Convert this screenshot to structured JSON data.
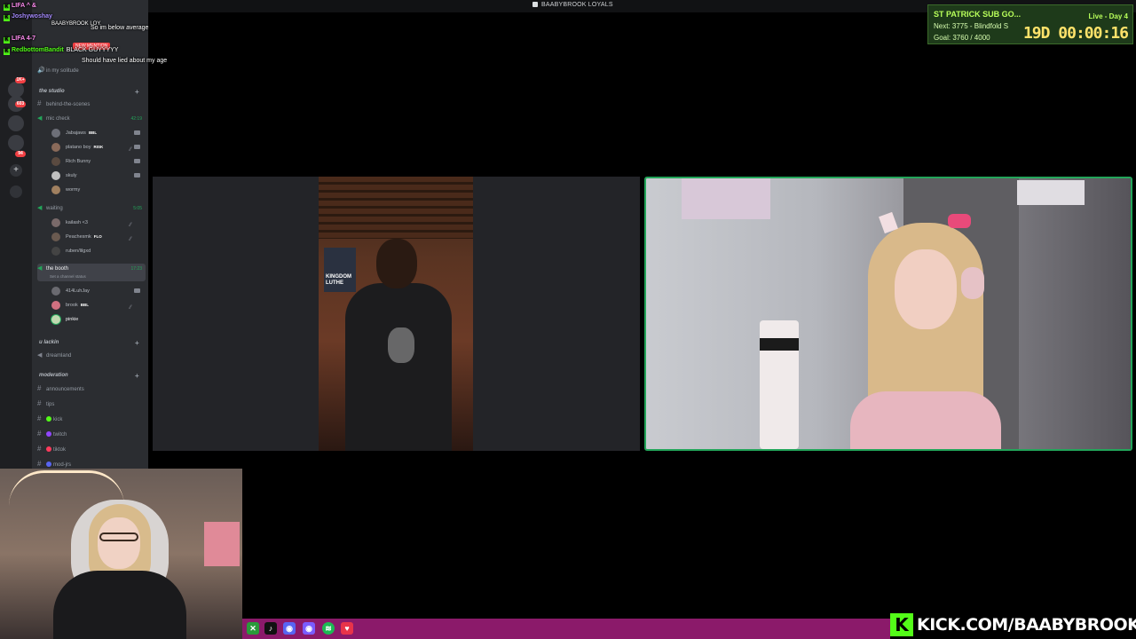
{
  "window": {
    "title": "BAABYBROOK LOYALS"
  },
  "chat": [
    {
      "badge": "K",
      "user": "LIFA ^ &",
      "text": "",
      "color": "#ff8cf0"
    },
    {
      "badge": "K",
      "user": "Joshywoshay",
      "text": "",
      "color": "#a78bff"
    },
    {
      "badge": "K",
      "user": "",
      "text": "So im below average",
      "color": "#ffffff"
    },
    {
      "badge": "K",
      "user": "LIFA 4-7",
      "text": "",
      "color": "#ff8cf0"
    },
    {
      "badge": "K",
      "user": "RedbottomBandit",
      "text": "BLACK GUYYYYY",
      "color": "#53fc18"
    },
    {
      "badge": "K",
      "user": "",
      "text": "Should have lied about my age",
      "color": "#ffffff"
    }
  ],
  "chat_misc": {
    "loy": "BAABYBROOK LOY",
    "new_mention": "NEW MENTION"
  },
  "sidebar": {
    "top_channel": "in my solitude",
    "cat1": "the studio",
    "ch_behind": "behind-the-scenes",
    "ch_mic": "mic check",
    "ch_mic_time": "42:19",
    "users1": [
      {
        "name": "Jabajaws",
        "tag": "BBL"
      },
      {
        "name": "platano boy",
        "tag": "RISK"
      },
      {
        "name": "Rich Bunny",
        "tag": ""
      },
      {
        "name": "skuly",
        "tag": ""
      },
      {
        "name": "wormy",
        "tag": ""
      }
    ],
    "ch_waiting": "waiting",
    "ch_waiting_time": "5:05",
    "users2": [
      {
        "name": "kailash <3",
        "tag": ""
      },
      {
        "name": "Peachesmk",
        "tag": "FLO"
      },
      {
        "name": "ruben/lilgxd",
        "tag": ""
      }
    ],
    "ch_booth": "the booth",
    "ch_booth_time": "17:23",
    "ch_booth_status": "Set a channel status",
    "users3": [
      {
        "name": "414LuhJay",
        "tag": ""
      },
      {
        "name": "brook",
        "tag": "BBL"
      },
      {
        "name": "pinkie",
        "tag": ""
      }
    ],
    "cat2": "u lackin",
    "ch_dreamland": "dreamland",
    "cat3": "moderation",
    "ch_announcements": "announcements",
    "ch_tips": "tips",
    "ch_kick": "kick",
    "ch_twitch": "twitch",
    "ch_tiktok": "tiktok",
    "ch_mod": "mod-jrs"
  },
  "rail_badges": [
    "1K+",
    "603",
    "94"
  ],
  "video": {
    "banner_text": "KINGDOM LUTHE"
  },
  "goal": {
    "title": "ST PATRICK SUB GO...",
    "next": "Next: 3775 - Blindfold S",
    "goal": "Goal: 3760 / 4000",
    "live": "Live - Day 4",
    "timer": "19D 00:00:16"
  },
  "footer": {
    "kick_url": "KICK.COM/BAABYBROOK"
  },
  "colors": {
    "accent": "#53fc18",
    "speaking": "#23a55a",
    "footer": "#8b1a6a"
  }
}
